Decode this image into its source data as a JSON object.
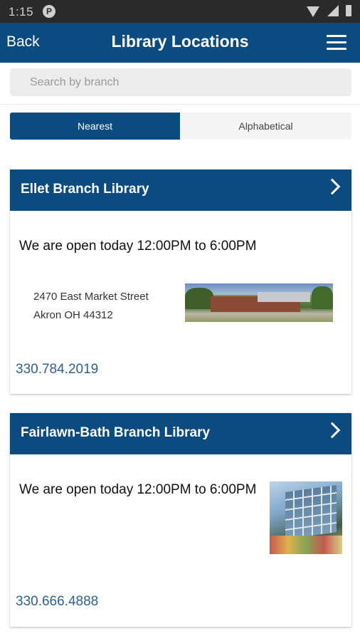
{
  "status_bar": {
    "time": "1:15",
    "app_icon": "P"
  },
  "app_bar": {
    "back_label": "Back",
    "title": "Library Locations",
    "menu_icon": "hamburger-menu-icon"
  },
  "search": {
    "placeholder": "Search by branch",
    "value": ""
  },
  "sort_tabs": [
    {
      "label": "Nearest",
      "selected": true
    },
    {
      "label": "Alphabetical",
      "selected": false
    }
  ],
  "colors": {
    "primary": "#0b4b7f",
    "link": "#2e5f91"
  },
  "branches": [
    {
      "name": "Ellet Branch Library",
      "hours": "We are open today 12:00PM to 6:00PM",
      "address_line1": "2470 East Market Street",
      "address_line2": "Akron OH 44312",
      "phone": "330.784.2019"
    },
    {
      "name": "Fairlawn-Bath Branch Library",
      "hours": "We are open today 12:00PM to 6:00PM",
      "phone": "330.666.4888"
    }
  ]
}
